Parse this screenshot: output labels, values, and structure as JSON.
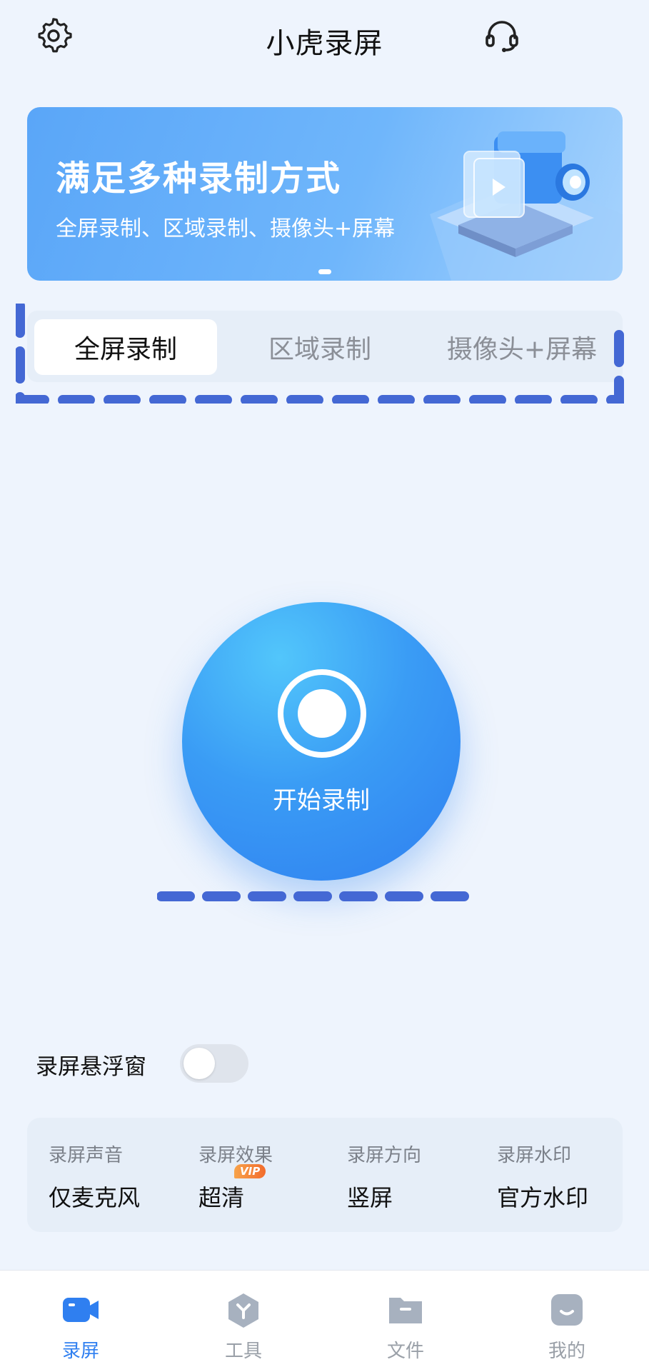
{
  "header": {
    "title": "小虎录屏",
    "settings_icon": "gear-icon",
    "support_icon": "headset-icon"
  },
  "banner": {
    "title": "满足多种录制方式",
    "subtitle": "全屏录制、区域录制、摄像头+屏幕"
  },
  "mode_tabs": [
    {
      "label": "全屏录制",
      "active": true
    },
    {
      "label": "区域录制",
      "active": false
    },
    {
      "label": "摄像头+屏幕",
      "active": false
    }
  ],
  "record": {
    "label": "开始录制",
    "icon": "record-icon"
  },
  "floating_window": {
    "label": "录屏悬浮窗",
    "enabled": false
  },
  "settings": [
    {
      "label": "录屏声音",
      "value": "仅麦克风"
    },
    {
      "label": "录屏效果",
      "value": "超清",
      "badge": "VIP"
    },
    {
      "label": "录屏方向",
      "value": "竖屏"
    },
    {
      "label": "录屏水印",
      "value": "官方水印"
    }
  ],
  "bottom_nav": [
    {
      "label": "录屏",
      "icon": "video-camera-icon",
      "active": true
    },
    {
      "label": "工具",
      "icon": "tools-icon",
      "active": false
    },
    {
      "label": "文件",
      "icon": "folder-icon",
      "active": false
    },
    {
      "label": "我的",
      "icon": "profile-icon",
      "active": false
    }
  ],
  "colors": {
    "accent": "#2f7ff0",
    "background": "#eef4fd",
    "dash": "#4468d4"
  }
}
